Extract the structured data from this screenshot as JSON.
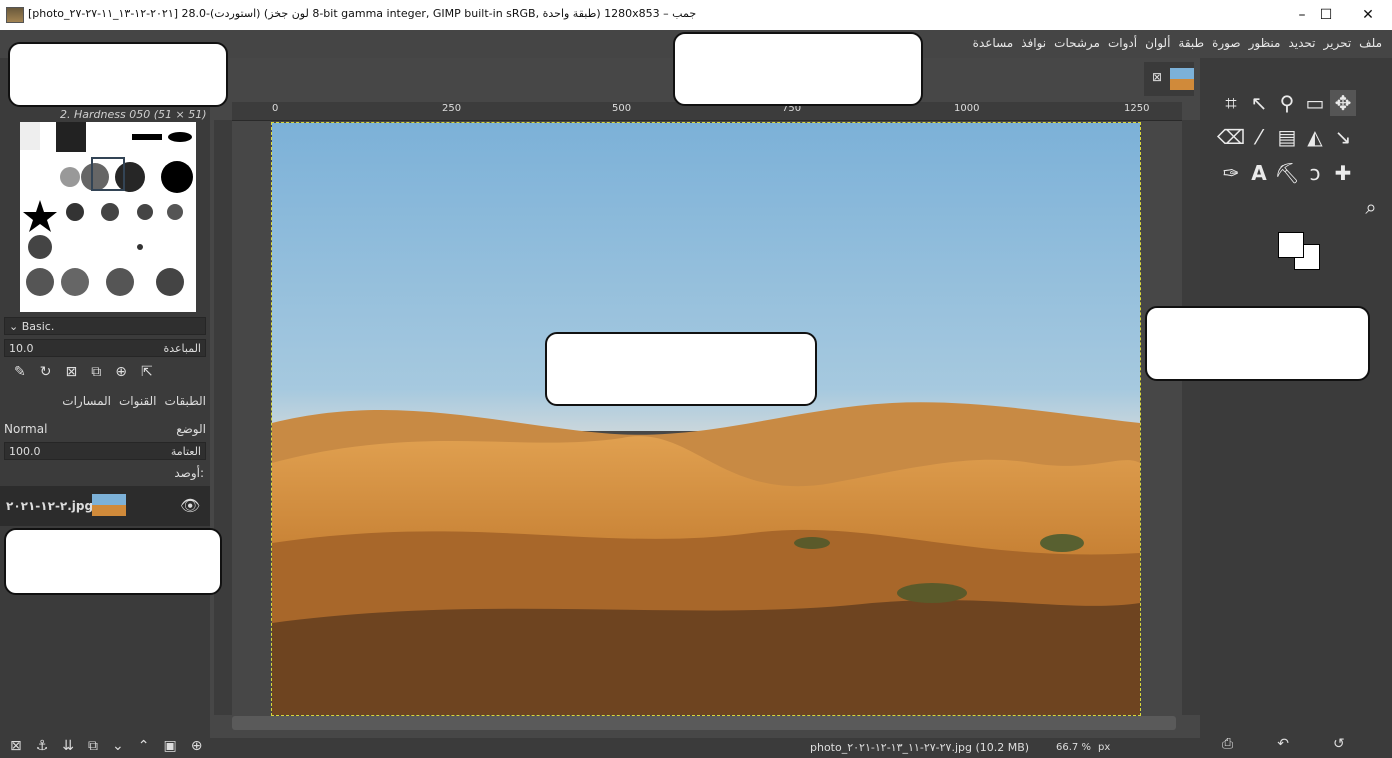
{
  "window": {
    "title": "[photo_٢٠٢١-١٢-١٣_١١-٢٧-٢٧] 28.0-(استوردت) (8 لون جخز-bit gamma integer, GIMP built-in sRGB, طبقة واحدة) 1280x853 – جمب",
    "minimize": "–",
    "maximize": "☐",
    "close": "✕"
  },
  "menu": {
    "items": [
      "ملف",
      "تحرير",
      "تحديد",
      "منظور",
      "صورة",
      "طبقة",
      "ألوان",
      "أدوات",
      "مرشحات",
      "نوافذ",
      "مساعدة"
    ]
  },
  "brushes": {
    "current": "2. Hardness 050 (51 × 51)",
    "preset": "Basic.",
    "spacing_value": "10.0",
    "spacing_label": "المباعدة"
  },
  "layers": {
    "tabs": [
      "الطبقات",
      "القنوات",
      "المسارات"
    ],
    "mode_label": "الوضع",
    "mode_value": "Normal",
    "opacity_label": "العتامة",
    "opacity_value": "100.0",
    "lock_label": "أوصد:",
    "layer_name": "٢-١٢-٢٠٢١.jpg"
  },
  "ruler": {
    "ticks": [
      "0",
      "250",
      "500",
      "750",
      "1000",
      "1250"
    ]
  },
  "status": {
    "file": "photo_٢٧-٢٧-١١_١٣-١٢-٢٠٢١.jpg (10.2 MB)",
    "zoom": "66.7 %",
    "unit": "px"
  },
  "icons": {
    "tools": [
      "crop-icon",
      "fuzzy-select-icon",
      "free-select-icon",
      "rect-select-icon",
      "move-icon",
      "eraser-icon",
      "paintbrush-icon",
      "gradient-icon",
      "bucket-fill-icon",
      "transform-icon",
      "color-picker-icon",
      "text-icon",
      "path-icon",
      "smudge-icon",
      "heal-icon",
      "zoom-icon"
    ]
  },
  "colors": {
    "bg": "#454545",
    "dock": "#3b3b3b",
    "sky": "#7cb1d8",
    "sand": "#d08a3a",
    "selection": "#d8d83a"
  }
}
